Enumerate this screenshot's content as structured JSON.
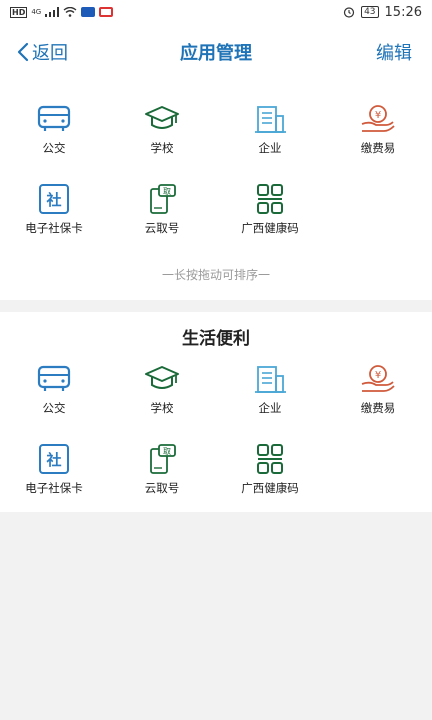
{
  "statusbar": {
    "left": {
      "hd": "HD",
      "net": "4G"
    },
    "battery": "43",
    "time": "15:26"
  },
  "header": {
    "back_label": "返回",
    "title": "应用管理",
    "edit_label": "编辑"
  },
  "my_apps": {
    "items": [
      {
        "label": "公交",
        "icon": "bus-icon"
      },
      {
        "label": "学校",
        "icon": "graduation-cap-icon"
      },
      {
        "label": "企业",
        "icon": "building-icon"
      },
      {
        "label": "缴费易",
        "icon": "payment-hand-icon"
      },
      {
        "label": "电子社保卡",
        "icon": "social-security-card-icon"
      },
      {
        "label": "云取号",
        "icon": "queue-ticket-icon"
      },
      {
        "label": "广西健康码",
        "icon": "health-qr-code-icon"
      }
    ],
    "hint": "一长按拖动可排序一"
  },
  "life_services": {
    "title": "生活便利",
    "items": [
      {
        "label": "公交",
        "icon": "bus-icon"
      },
      {
        "label": "学校",
        "icon": "graduation-cap-icon"
      },
      {
        "label": "企业",
        "icon": "building-icon"
      },
      {
        "label": "缴费易",
        "icon": "payment-hand-icon"
      },
      {
        "label": "电子社保卡",
        "icon": "social-security-card-icon"
      },
      {
        "label": "云取号",
        "icon": "queue-ticket-icon"
      },
      {
        "label": "广西健康码",
        "icon": "health-qr-code-icon"
      }
    ]
  },
  "colors": {
    "accent": "#1f73b7",
    "bus": "#2b7cc1",
    "school": "#1b6b3a",
    "building": "#4aa7d6",
    "payment": "#d05a3c",
    "card": "#2b7cc1",
    "ticket": "#1b6b3a",
    "qr": "#1b6b3a",
    "background": "#f2f2f2"
  }
}
